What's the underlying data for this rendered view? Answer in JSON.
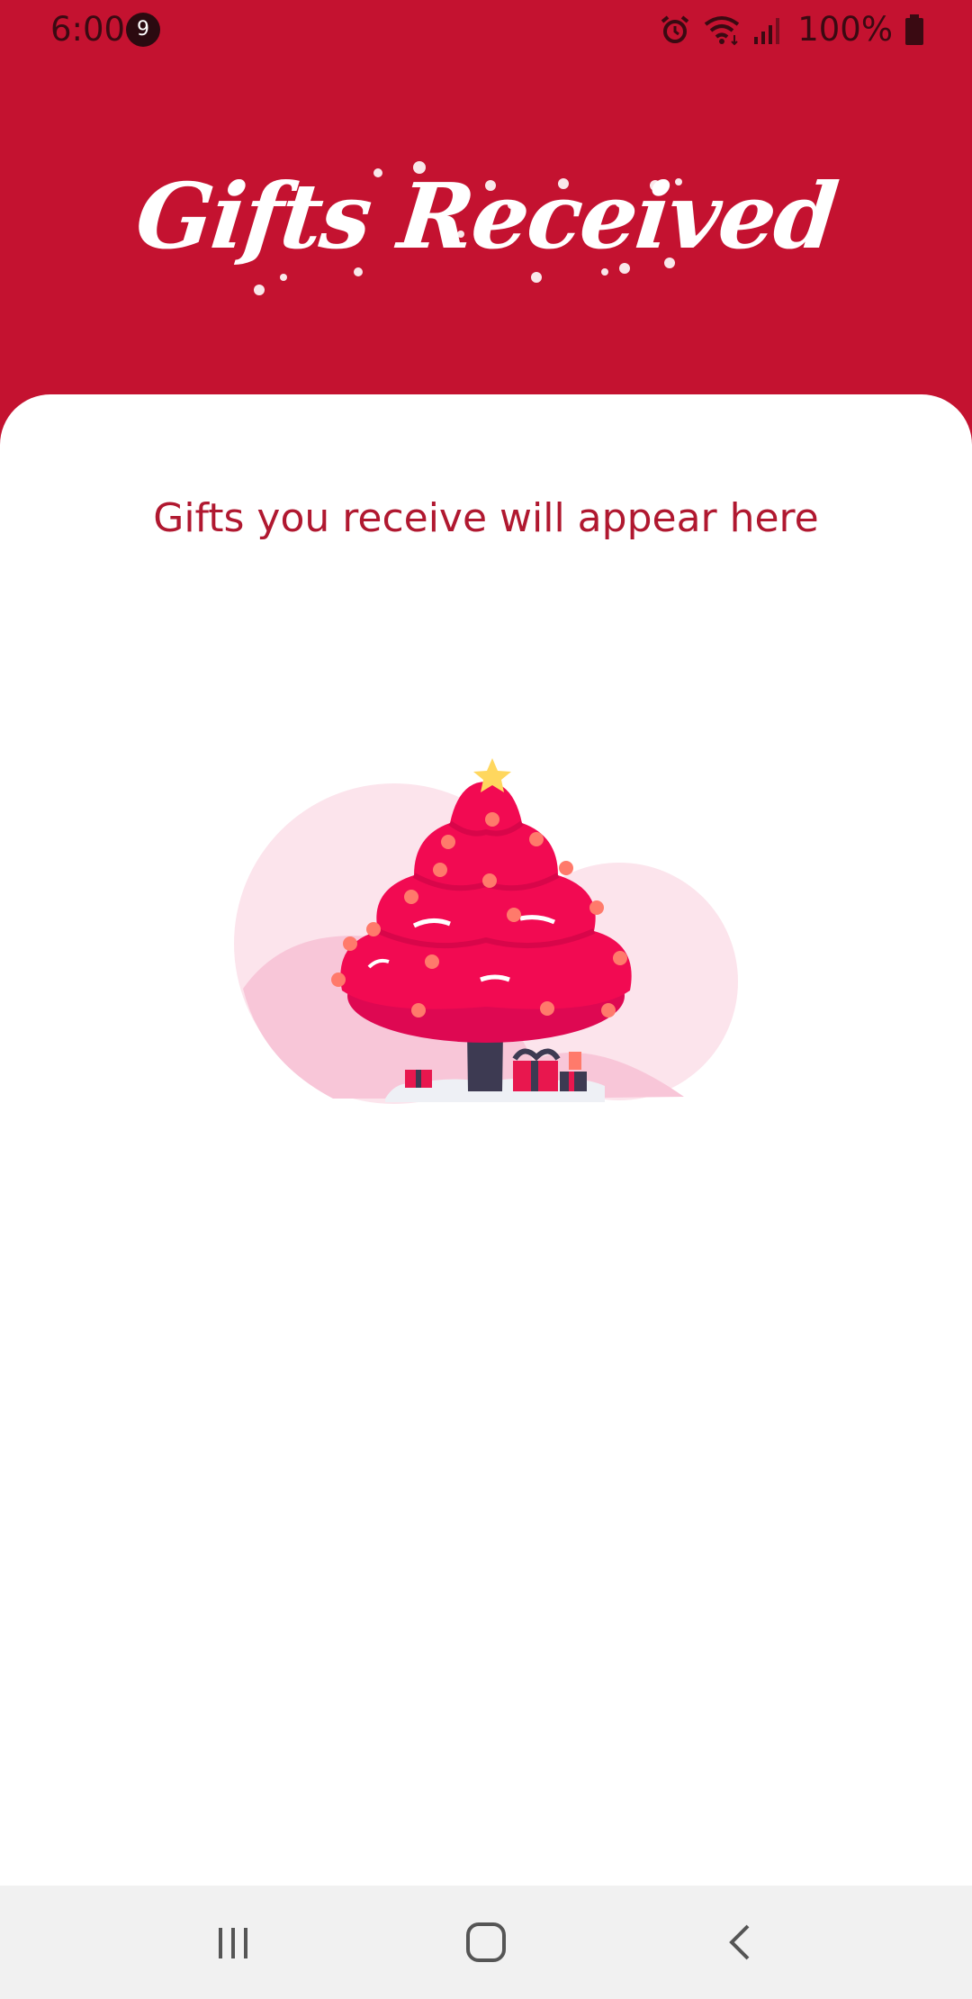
{
  "status_bar": {
    "time": "6:00",
    "notification_count": "9",
    "battery_percent": "100%",
    "icons": [
      "alarm-icon",
      "wifi-icon",
      "signal-icon",
      "battery-icon"
    ]
  },
  "header": {
    "title": "Gifts Received",
    "background_color": "#c41230"
  },
  "main": {
    "empty_message": "Gifts you receive will appear here",
    "illustration": "christmas-tree-with-gifts"
  },
  "nav_bar": {
    "buttons": [
      "recents-icon",
      "home-icon",
      "back-icon"
    ]
  },
  "colors": {
    "accent": "#c41230",
    "message_text": "#b01830",
    "tree": "#f20a52",
    "nav_background": "#f1f1f1"
  }
}
